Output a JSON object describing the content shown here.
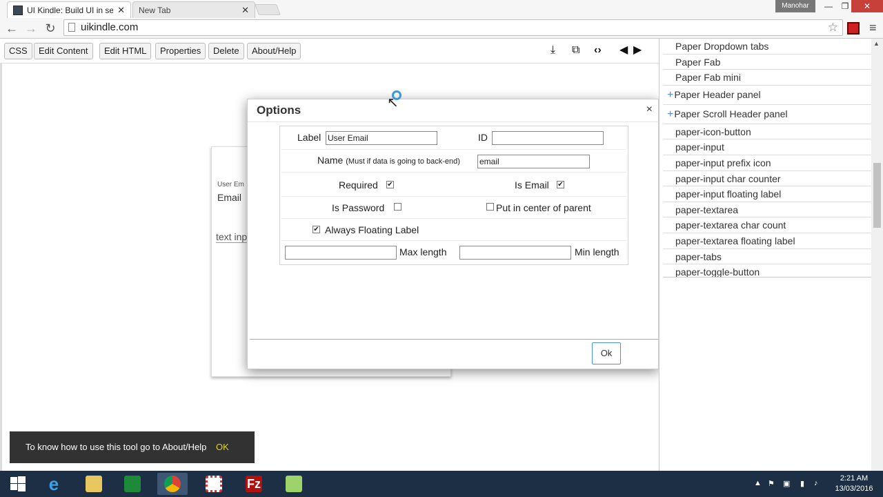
{
  "browser": {
    "tabs": [
      {
        "title": "UI Kindle: Build UI in secon",
        "close": "✕"
      },
      {
        "title": "New Tab",
        "close": "✕"
      }
    ],
    "user": "Manohar",
    "url": "uikindle.com",
    "window_controls": {
      "minimize": "—",
      "maximize": "❐",
      "close": "✕"
    }
  },
  "toolbar": {
    "buttons": [
      "CSS",
      "Edit Content",
      "Edit HTML",
      "Properties",
      "Delete",
      "About/Help"
    ],
    "icons": [
      "download-icon",
      "open-external-icon",
      "code-icon",
      "arrow-left-icon",
      "arrow-right-icon"
    ]
  },
  "canvas": {
    "card_small_label": "User Em",
    "card_email": "Email",
    "card_text": "text inp"
  },
  "modal": {
    "title": "Options",
    "close": "×",
    "label_label": "Label",
    "label_value": "User Email",
    "id_label": "ID",
    "id_value": "",
    "name_label": "Name",
    "name_hint": "(Must if data is going to back-end)",
    "name_value": "email",
    "required_label": "Required",
    "required_checked": true,
    "is_email_label": "Is Email",
    "is_email_checked": true,
    "is_password_label": "Is Password",
    "is_password_checked": false,
    "center_label": "Put in center of parent",
    "center_checked": false,
    "floating_label": "Always Floating Label",
    "floating_checked": true,
    "max_length_label": "Max length",
    "max_length_value": "",
    "min_length_label": "Min length",
    "min_length_value": "",
    "ok": "Ok"
  },
  "right_panel": {
    "items": [
      {
        "label": "Paper Dropdown tabs",
        "expandable": false
      },
      {
        "label": "Paper Fab",
        "expandable": false
      },
      {
        "label": "Paper Fab mini",
        "expandable": false
      },
      {
        "label": "Paper Header panel",
        "expandable": true
      },
      {
        "label": "Paper Scroll Header panel",
        "expandable": true
      },
      {
        "label": "paper-icon-button",
        "expandable": false
      },
      {
        "label": "paper-input",
        "expandable": false
      },
      {
        "label": "paper-input prefix icon",
        "expandable": false
      },
      {
        "label": "paper-input char counter",
        "expandable": false
      },
      {
        "label": "paper-input floating label",
        "expandable": false
      },
      {
        "label": "paper-textarea",
        "expandable": false
      },
      {
        "label": "paper-textarea char count",
        "expandable": false
      },
      {
        "label": "paper-textarea floating label",
        "expandable": false
      },
      {
        "label": "paper-tabs",
        "expandable": false
      },
      {
        "label": "paper-toggle-button",
        "expandable": false
      }
    ]
  },
  "toast": {
    "message": "To know how to use this tool go to About/Help",
    "ok": "OK"
  },
  "taskbar": {
    "time": "2:21 AM",
    "date": "13/03/2016",
    "apps": [
      "start-icon",
      "internet-explorer-icon",
      "file-explorer-icon",
      "store-icon",
      "chrome-icon",
      "apps-icon",
      "filezilla-icon",
      "notepad-icon"
    ]
  }
}
